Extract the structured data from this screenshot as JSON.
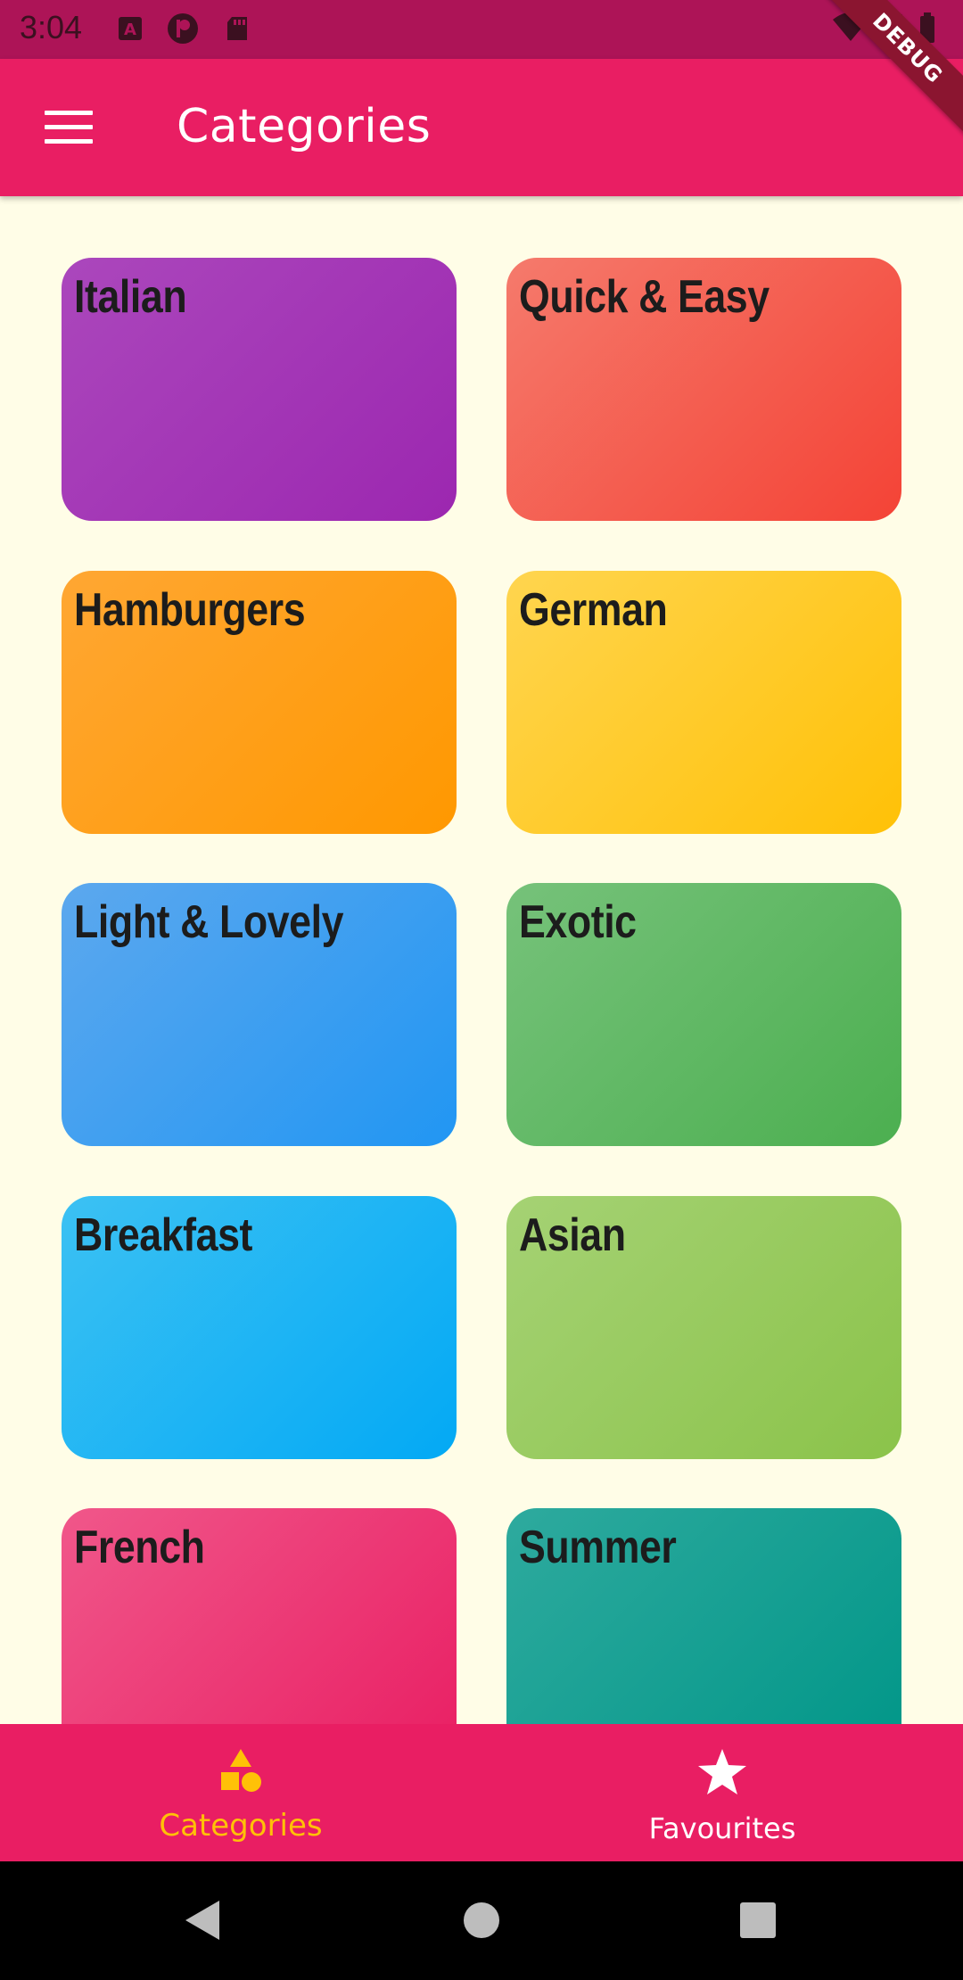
{
  "status_bar": {
    "time": "3:04",
    "left_icons": [
      "a-icon",
      "record-icon",
      "sd-card-icon"
    ],
    "right_icons": [
      "wifi-icon",
      "cell-signal-icon",
      "battery-icon"
    ]
  },
  "app_bar": {
    "title": "Categories",
    "debug_banner": "DEBUG"
  },
  "categories": [
    {
      "title": "Italian",
      "color_start": "#AB47BC",
      "color_end": "#9C27B0"
    },
    {
      "title": "Quick & Easy",
      "color_start": "#F57A6C",
      "color_end": "#F44336"
    },
    {
      "title": "Hamburgers",
      "color_start": "#FFA733",
      "color_end": "#FF9800"
    },
    {
      "title": "German",
      "color_start": "#FFD54F",
      "color_end": "#FFC107"
    },
    {
      "title": "Light & Lovely",
      "color_start": "#5CA8EE",
      "color_end": "#2196F3"
    },
    {
      "title": "Exotic",
      "color_start": "#76C27A",
      "color_end": "#4CAF50"
    },
    {
      "title": "Breakfast",
      "color_start": "#3CC1F3",
      "color_end": "#03A9F4"
    },
    {
      "title": "Asian",
      "color_start": "#A5D274",
      "color_end": "#8BC34A"
    },
    {
      "title": "French",
      "color_start": "#F0578A",
      "color_end": "#E91E63"
    },
    {
      "title": "Summer",
      "color_start": "#2EAA9E",
      "color_end": "#009688"
    }
  ],
  "bottom_nav": {
    "items": [
      {
        "label": "Categories",
        "icon": "category-icon",
        "active": true
      },
      {
        "label": "Favourites",
        "icon": "star-icon",
        "active": false
      }
    ],
    "active_color": "#FFC107",
    "inactive_color": "#FFFFFF"
  },
  "colors": {
    "primary": "#E91E63",
    "status_bar": "#AD1457",
    "background": "#FFFDE7"
  }
}
